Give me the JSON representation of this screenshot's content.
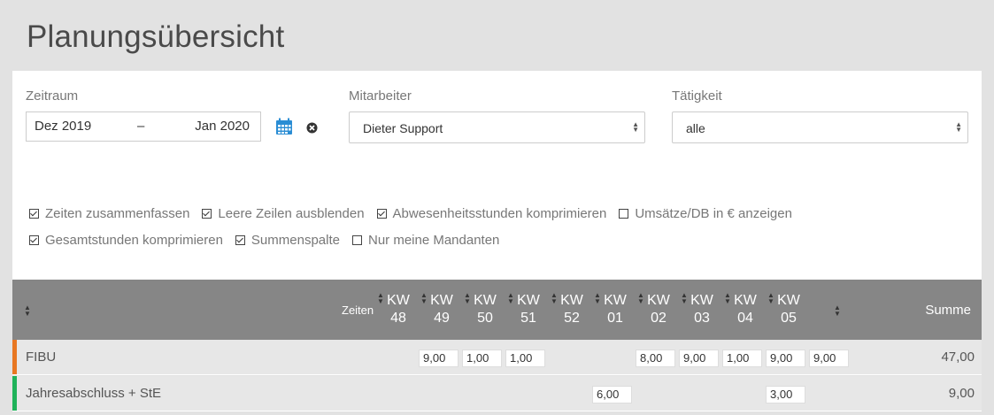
{
  "page": {
    "title": "Planungsübersicht"
  },
  "filters": {
    "zeitraum_label": "Zeitraum",
    "from": "Dez 2019",
    "dash": "–",
    "to": "Jan 2020",
    "mitarbeiter_label": "Mitarbeiter",
    "mitarbeiter_value": "Dieter Support",
    "taetigkeit_label": "Tätigkeit",
    "taetigkeit_value": "alle"
  },
  "options": [
    {
      "label": "Zeiten zusammenfassen",
      "checked": true
    },
    {
      "label": "Leere Zeilen ausblenden",
      "checked": true
    },
    {
      "label": "Abwesenheitsstunden komprimieren",
      "checked": true
    },
    {
      "label": "Umsätze/DB in € anzeigen",
      "checked": false
    },
    {
      "label": "Gesamtstunden komprimieren",
      "checked": true
    },
    {
      "label": "Summenspalte",
      "checked": true
    },
    {
      "label": "Nur meine Mandanten",
      "checked": false
    }
  ],
  "table": {
    "zeiten_label": "Zeiten",
    "summe_label": "Summe",
    "weeks": [
      {
        "kw": "KW",
        "num": "48"
      },
      {
        "kw": "KW",
        "num": "49"
      },
      {
        "kw": "KW",
        "num": "50"
      },
      {
        "kw": "KW",
        "num": "51"
      },
      {
        "kw": "KW",
        "num": "52"
      },
      {
        "kw": "KW",
        "num": "01"
      },
      {
        "kw": "KW",
        "num": "02"
      },
      {
        "kw": "KW",
        "num": "03"
      },
      {
        "kw": "KW",
        "num": "04"
      },
      {
        "kw": "KW",
        "num": "05"
      }
    ],
    "rows": [
      {
        "name": "FIBU",
        "color": "#e87722",
        "cells": [
          "9,00",
          "1,00",
          "1,00",
          "",
          "",
          "8,00",
          "9,00",
          "1,00",
          "9,00",
          "9,00"
        ],
        "sum": "47,00"
      },
      {
        "name": "Jahresabschluss + StE",
        "color": "#1fb25a",
        "cells": [
          "",
          "",
          "",
          "",
          "6,00",
          "",
          "",
          "",
          "3,00",
          ""
        ],
        "sum": "9,00"
      }
    ]
  },
  "colors": {
    "accent": "#2a8dd4",
    "header_bg": "#868686"
  }
}
